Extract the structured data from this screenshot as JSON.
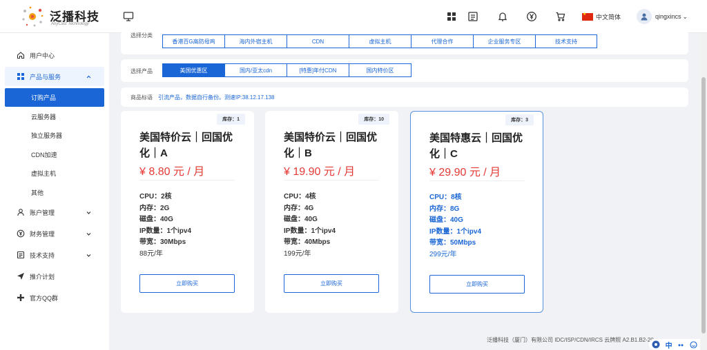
{
  "header": {
    "logo_text": "泛播科技",
    "logo_sub": "AnyCast Technology",
    "language": "中文简体",
    "username": "qingxincs",
    "user_chevron": "⌄"
  },
  "sidebar": {
    "user_center": "用户中心",
    "products": "产品与服务",
    "sub_items": [
      "订购产品",
      "云服务器",
      "独立服务器",
      "CDN加速",
      "虚拟主机",
      "其他"
    ],
    "account": "账户管理",
    "finance": "财务管理",
    "support": "技术支持",
    "referral": "推介计划",
    "qq_group": "官方QQ群"
  },
  "category": {
    "label": "选择分类",
    "items": [
      "香港百G高防母鸡",
      "海内外宿主机",
      "CDN",
      "虚拟主机",
      "代理合作",
      "企业服务专区",
      "技术支持"
    ]
  },
  "product_select": {
    "label": "选择产品",
    "items": [
      "美国优惠区",
      "国内/亚太cdn",
      "[特惠]年付CDN",
      "国内特价区"
    ],
    "active_index": 0
  },
  "remark": {
    "label": "商品标语",
    "text": "引流产品，数据自行备份。测速IP:38.12.17.138"
  },
  "cards": [
    {
      "stock": "库存：1",
      "name_line1": "美国特价云｜回国优",
      "name_line2": "化｜A",
      "price": "¥ 8.80 元 / 月",
      "cpu": "CPU：2核",
      "mem": "内存：2G",
      "disk": "磁盘：40G",
      "ip": "IP数量：1个ipv4",
      "bw": "带宽：30Mbps",
      "yearly": "88元/年",
      "buy": "立即购买"
    },
    {
      "stock": "库存：10",
      "name_line1": "美国特价云｜回国优",
      "name_line2": "化｜B",
      "price": "¥ 19.90 元 / 月",
      "cpu": "CPU：4核",
      "mem": "内存：4G",
      "disk": "磁盘：40G",
      "ip": "IP数量：1个ipv4",
      "bw": "带宽：40Mbps",
      "yearly": "199元/年",
      "buy": "立即购买"
    },
    {
      "stock": "库存：3",
      "name_line1": "美国特惠云｜回国优",
      "name_line2": "化｜C",
      "price": "¥ 29.90 元 / 月",
      "cpu": "CPU：8核",
      "mem": "内存：8G",
      "disk": "磁盘：40G",
      "ip": "IP数量：1个ipv4",
      "bw": "带宽：50Mbps",
      "yearly": "299元/年",
      "buy": "立即购买"
    }
  ],
  "footer": "泛播科技（厦门）有限公司 IDC/ISP/CDN/IRCS 云牌照 A2.B1.B2-20",
  "ime": {
    "mode": "中"
  },
  "colors": {
    "accent": "#1a66d6",
    "price": "#e53935",
    "bg": "#f0f2f5"
  },
  "icons": [
    "monitor-icon",
    "grid-icon",
    "document-icon",
    "bell-icon",
    "yuan-icon",
    "cart-icon",
    "home-icon",
    "apps-icon",
    "user-icon",
    "money-icon",
    "list-icon",
    "send-icon",
    "plus-icon"
  ]
}
